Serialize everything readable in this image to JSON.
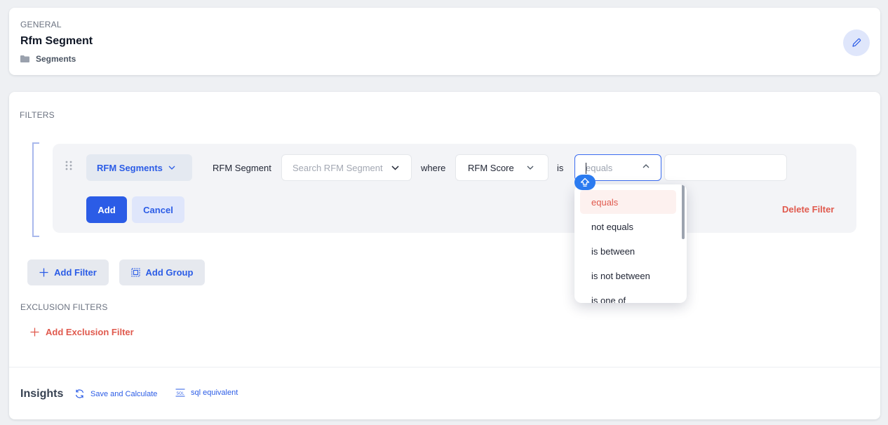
{
  "general": {
    "section_label": "GENERAL",
    "title": "Rfm Segment",
    "folder_label": "Segments"
  },
  "filters": {
    "section_label": "FILTERS",
    "row": {
      "category": "RFM Segments",
      "field_label": "RFM Segment",
      "value_placeholder": "Search RFM Segment",
      "where_label": "where",
      "attribute": "RFM Score",
      "is_label": "is",
      "operator_value": "equals",
      "add_label": "Add",
      "cancel_label": "Cancel",
      "delete_label": "Delete Filter"
    },
    "operator_options": [
      "equals",
      "not equals",
      "is between",
      "is not between",
      "is one of"
    ],
    "selected_operator": "equals",
    "add_filter_label": "Add Filter",
    "add_group_label": "Add Group"
  },
  "exclusion": {
    "section_label": "EXCLUSION FILTERS",
    "add_label": "Add Exclusion Filter"
  },
  "insights": {
    "title": "Insights",
    "save_calc_label": "Save and Calculate",
    "sql_label": "sql equivalent"
  },
  "colors": {
    "accent": "#2b5ce6",
    "danger": "#e05a4e",
    "background": "#eef0f3"
  },
  "icons": [
    "folder-icon",
    "pencil-icon",
    "drag-handle-icon",
    "chevron-down-icon",
    "chevron-up-icon",
    "plus-icon",
    "group-icon",
    "refresh-icon",
    "sql-icon",
    "scroll-up-icon"
  ]
}
